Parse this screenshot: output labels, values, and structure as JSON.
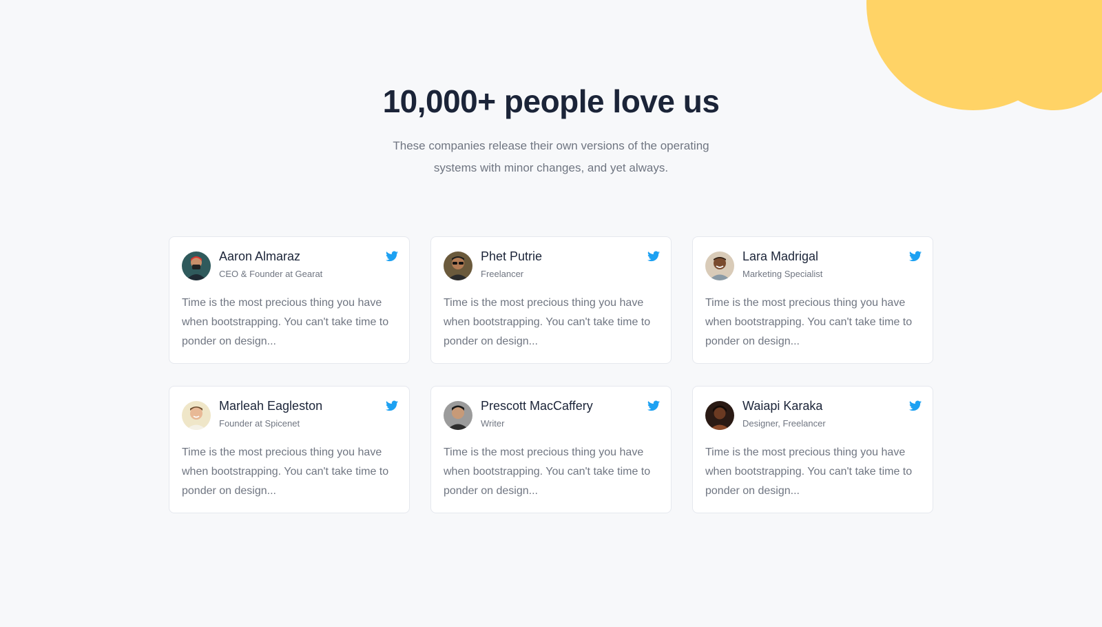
{
  "section": {
    "title": "10,000+ people love us",
    "subtitle": "These companies release their own versions of the operating systems with minor changes, and yet always."
  },
  "colors": {
    "accent": "#ffd366",
    "twitter": "#1da1f2"
  },
  "testimonials": [
    {
      "name": "Aaron Almaraz",
      "role": "CEO & Founder at Gearat",
      "quote": "Time is the most precious thing you have when bootstrapping. You can't take time to ponder on design...",
      "icon": "twitter-icon"
    },
    {
      "name": "Phet Putrie",
      "role": "Freelancer",
      "quote": "Time is the most precious thing you have when bootstrapping. You can't take time to ponder on design...",
      "icon": "twitter-icon"
    },
    {
      "name": "Lara Madrigal",
      "role": "Marketing Specialist",
      "quote": "Time is the most precious thing you have when bootstrapping. You can't take time to ponder on design...",
      "icon": "twitter-icon"
    },
    {
      "name": "Marleah Eagleston",
      "role": "Founder at Spicenet",
      "quote": "Time is the most precious thing you have when bootstrapping. You can't take time to ponder on design...",
      "icon": "twitter-icon"
    },
    {
      "name": "Prescott MacCaffery",
      "role": "Writer",
      "quote": "Time is the most precious thing you have when bootstrapping. You can't take time to ponder on design...",
      "icon": "twitter-icon"
    },
    {
      "name": "Waiapi Karaka",
      "role": "Designer, Freelancer",
      "quote": "Time is the most precious thing you have when bootstrapping. You can't take time to ponder on design...",
      "icon": "twitter-icon"
    }
  ]
}
